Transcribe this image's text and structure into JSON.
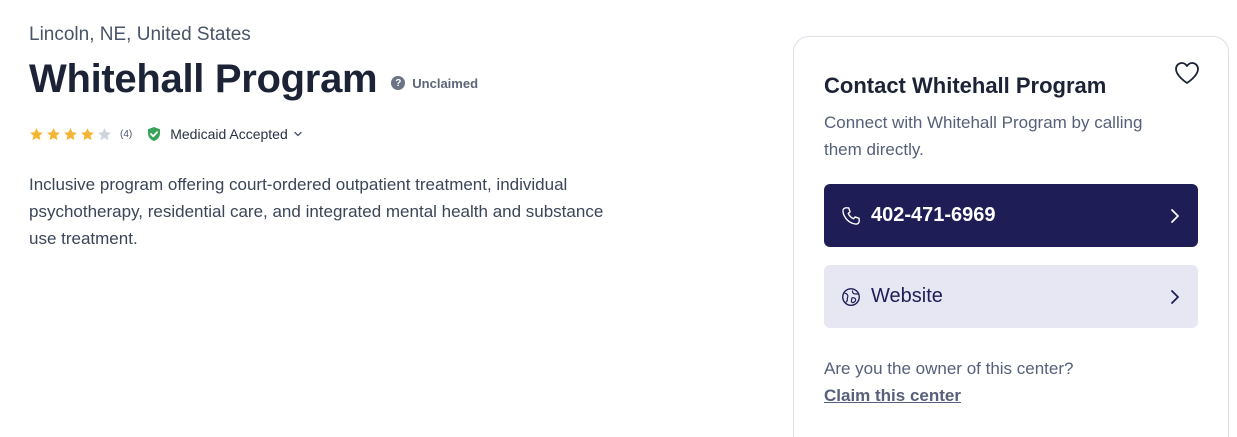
{
  "listing": {
    "location": "Lincoln, NE, United States",
    "title": "Whitehall Program",
    "status_badge": "Unclaimed",
    "rating": {
      "value": 4,
      "max": 5,
      "count": "(4)"
    },
    "insurance": "Medicaid Accepted",
    "description": "Inclusive program offering court-ordered outpatient treatment, individual psychotherapy, residential care, and integrated mental health and substance use treatment."
  },
  "contact": {
    "title": "Contact Whitehall Program",
    "subtitle": "Connect with Whitehall Program by calling them directly.",
    "phone_label": "402-471-6969",
    "website_label": "Website",
    "owner_question": "Are you the owner of this center?",
    "claim_link": "Claim this center"
  },
  "icons": {
    "status": "question-icon",
    "insurance": "shield-check-icon",
    "favorite": "heart-icon",
    "phone": "phone-icon",
    "website": "globe-icon",
    "chevron": "chevron-right-icon"
  },
  "colors": {
    "star_filled": "#f4b532",
    "star_empty": "#cfd3dc",
    "shield": "#3aa35a",
    "primary": "#1e1d56",
    "secondary_bg": "#e7e6f3"
  }
}
